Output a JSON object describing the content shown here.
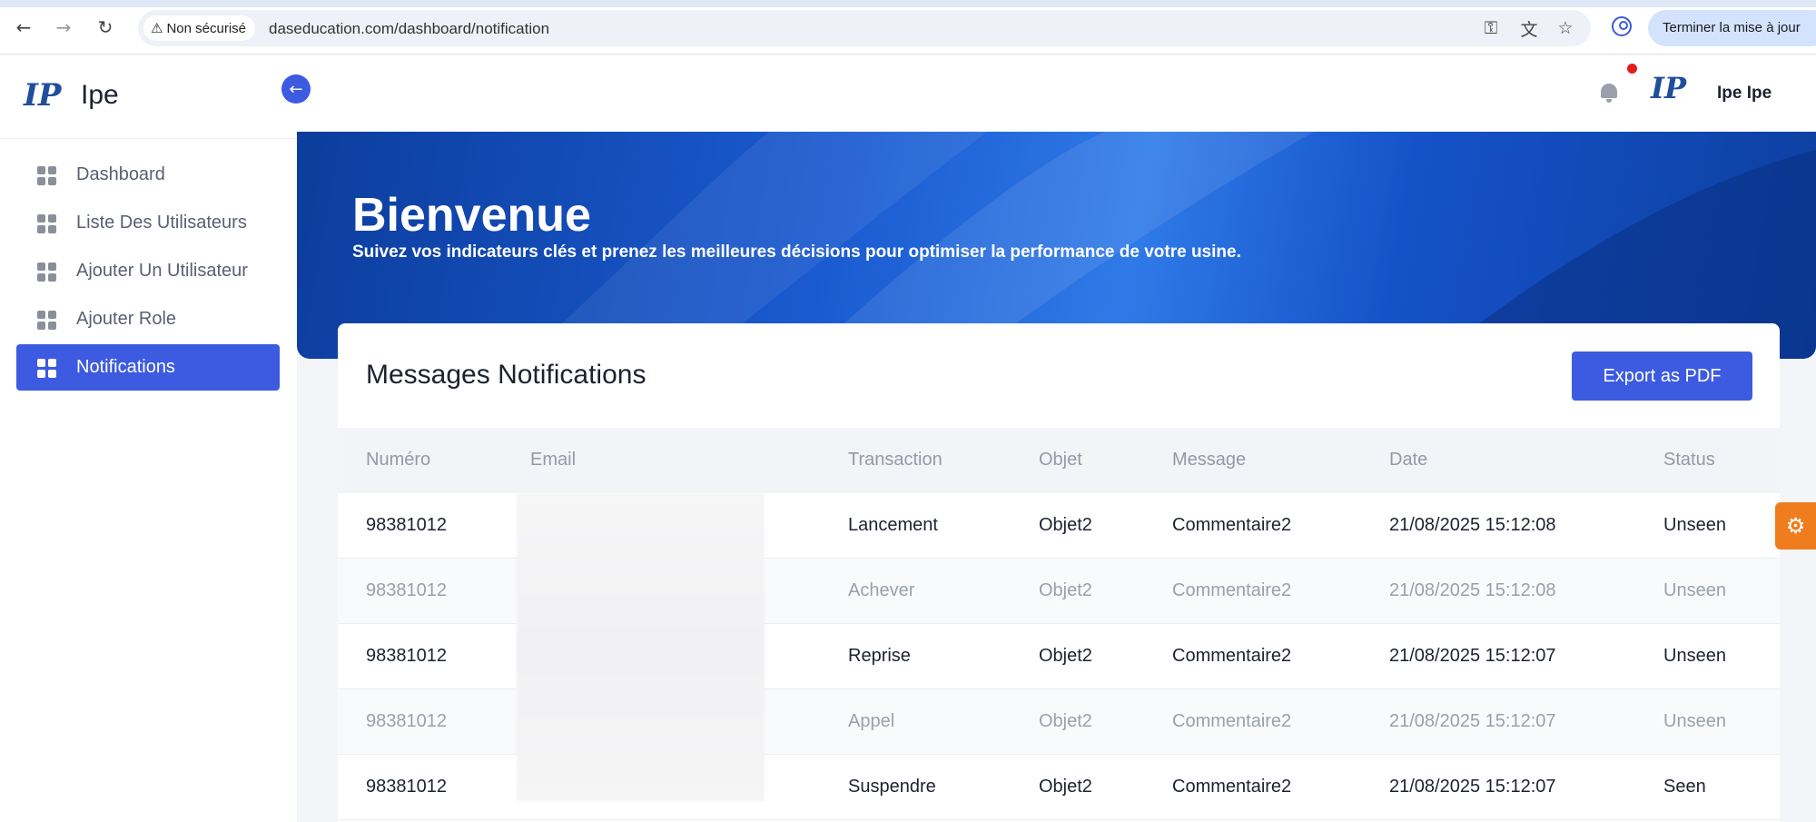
{
  "browser": {
    "security_label": "Non sécurisé",
    "url": "daseducation.com/dashboard/notification",
    "update_button": "Terminer la mise à jour"
  },
  "sidebar": {
    "brand_name": "Ipe",
    "logo_text": "IP",
    "items": [
      {
        "label": "Dashboard",
        "active": false
      },
      {
        "label": "Liste Des Utilisateurs",
        "active": false
      },
      {
        "label": "Ajouter Un Utilisateur",
        "active": false
      },
      {
        "label": "Ajouter Role",
        "active": false
      },
      {
        "label": "Notifications",
        "active": true
      }
    ]
  },
  "header": {
    "user_name": "Ipe Ipe",
    "has_unread": true
  },
  "hero": {
    "title": "Bienvenue",
    "subtitle": "Suivez vos indicateurs clés et prenez les meilleures décisions pour optimiser la performance de votre usine."
  },
  "notifications": {
    "title": "Messages Notifications",
    "export_label": "Export as PDF",
    "columns": [
      "Numéro",
      "Email",
      "Transaction",
      "Objet",
      "Message",
      "Date",
      "Status"
    ],
    "rows": [
      {
        "numero": "98381012",
        "transaction": "Lancement",
        "objet": "Objet2",
        "message": "Commentaire2",
        "date": "21/08/2025 15:12:08",
        "status": "Unseen"
      },
      {
        "numero": "98381012",
        "transaction": "Achever",
        "objet": "Objet2",
        "message": "Commentaire2",
        "date": "21/08/2025 15:12:08",
        "status": "Unseen"
      },
      {
        "numero": "98381012",
        "transaction": "Reprise",
        "objet": "Objet2",
        "message": "Commentaire2",
        "date": "21/08/2025 15:12:07",
        "status": "Unseen"
      },
      {
        "numero": "98381012",
        "transaction": "Appel",
        "objet": "Objet2",
        "message": "Commentaire2",
        "date": "21/08/2025 15:12:07",
        "status": "Unseen"
      },
      {
        "numero": "98381012",
        "transaction": "Suspendre",
        "objet": "Objet2",
        "message": "Commentaire2",
        "date": "21/08/2025 15:12:07",
        "status": "Seen"
      }
    ]
  },
  "colors": {
    "accent": "#3d5be0",
    "settings_tab": "#f07d1d",
    "notification_dot": "#e51c1c"
  }
}
